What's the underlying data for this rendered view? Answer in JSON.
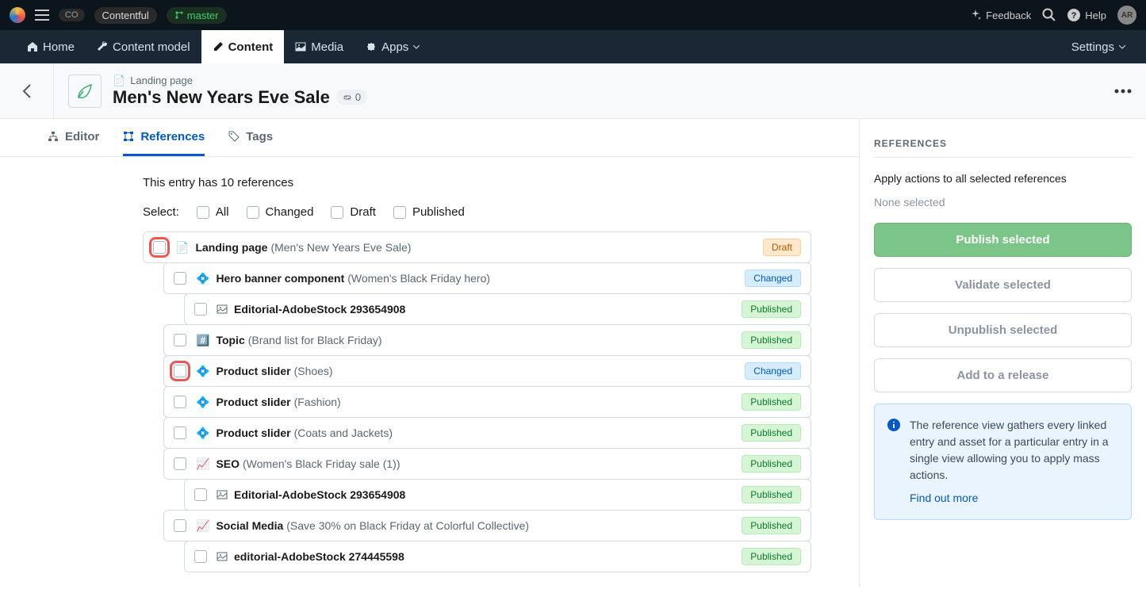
{
  "topbar": {
    "org_badge": "CO",
    "space_name": "Contentful",
    "env_name": "master",
    "feedback": "Feedback",
    "help": "Help",
    "avatar": "AR"
  },
  "nav": {
    "home": "Home",
    "content_model": "Content model",
    "content": "Content",
    "media": "Media",
    "apps": "Apps",
    "settings": "Settings"
  },
  "header": {
    "content_type": "Landing page",
    "title": "Men's New Years Eve Sale",
    "link_count": "0"
  },
  "tabs": {
    "editor": "Editor",
    "references": "References",
    "tags": "Tags"
  },
  "summary": "This entry has 10 references",
  "select": {
    "label": "Select:",
    "all": "All",
    "changed": "Changed",
    "draft": "Draft",
    "published": "Published"
  },
  "status": {
    "draft": "Draft",
    "changed": "Changed",
    "published": "Published"
  },
  "tree": [
    {
      "indent": 0,
      "icon": "page",
      "type": "Landing page",
      "name": "(Men's New Years Eve Sale)",
      "status": "draft",
      "highlighted": true
    },
    {
      "indent": 1,
      "icon": "diamond",
      "type": "Hero banner component",
      "name": "(Women's Black Friday hero)",
      "status": "changed"
    },
    {
      "indent": 2,
      "icon": "image",
      "type": "Editorial-AdobeStock 293654908",
      "name": "",
      "status": "published"
    },
    {
      "indent": 1,
      "icon": "hash",
      "type": "Topic",
      "name": "(Brand list for Black Friday)",
      "status": "published"
    },
    {
      "indent": 1,
      "icon": "diamond",
      "type": "Product slider",
      "name": "(Shoes)",
      "status": "changed",
      "highlighted": true
    },
    {
      "indent": 1,
      "icon": "diamond",
      "type": "Product slider",
      "name": "(Fashion)",
      "status": "published"
    },
    {
      "indent": 1,
      "icon": "diamond",
      "type": "Product slider",
      "name": "(Coats and Jackets)",
      "status": "published"
    },
    {
      "indent": 1,
      "icon": "chart",
      "type": "SEO",
      "name": "(Women's Black Friday sale (1))",
      "status": "published"
    },
    {
      "indent": 2,
      "icon": "image",
      "type": "Editorial-AdobeStock 293654908",
      "name": "",
      "status": "published"
    },
    {
      "indent": 1,
      "icon": "chart",
      "type": "Social Media",
      "name": "(Save 30% on Black Friday at Colorful Collective)",
      "status": "published"
    },
    {
      "indent": 2,
      "icon": "image",
      "type": "editorial-AdobeStock 274445598",
      "name": "",
      "status": "published"
    }
  ],
  "sidebar": {
    "title": "REFERENCES",
    "subtitle": "Apply actions to all selected references",
    "none": "None selected",
    "publish": "Publish selected",
    "validate": "Validate selected",
    "unpublish": "Unpublish selected",
    "add_release": "Add to a release",
    "info_text": "The reference view gathers every linked entry and asset for a particular entry in a single view allowing you to apply mass actions.",
    "info_link": "Find out more"
  }
}
